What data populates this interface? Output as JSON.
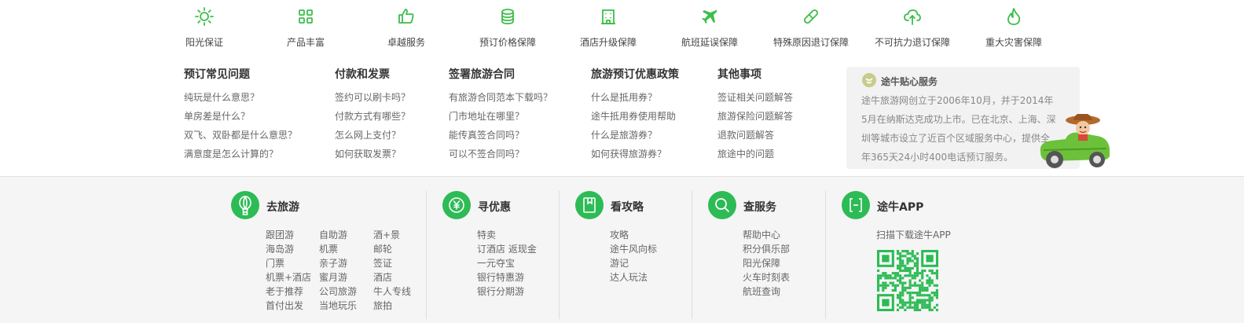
{
  "guarantees": [
    {
      "label": "阳光保证",
      "icon": "sun-icon"
    },
    {
      "label": "产品丰富",
      "icon": "grid-icon"
    },
    {
      "label": "卓越服务",
      "icon": "thumbs-up-icon"
    },
    {
      "label": "预订价格保障",
      "icon": "coins-stack-icon"
    },
    {
      "label": "酒店升级保障",
      "icon": "hotel-building-icon"
    },
    {
      "label": "航班延误保障",
      "icon": "airplane-icon"
    },
    {
      "label": "特殊原因退订保障",
      "icon": "pill-icon"
    },
    {
      "label": "不可抗力退订保障",
      "icon": "cloud-upload-icon"
    },
    {
      "label": "重大灾害保障",
      "icon": "flame-icon"
    }
  ],
  "help": [
    {
      "title": "预订常见问题",
      "links": [
        "纯玩是什么意思？",
        "单房差是什么？",
        "双飞、双卧都是什么意思？",
        "满意度是怎么计算的？"
      ]
    },
    {
      "title": "付款和发票",
      "links": [
        "签约可以刷卡吗？",
        "付款方式有哪些？",
        "怎么网上支付？",
        "如何获取发票？"
      ]
    },
    {
      "title": "签署旅游合同",
      "links": [
        "有旅游合同范本下载吗？",
        "门市地址在哪里？",
        "能传真签合同吗？",
        "可以不签合同吗？"
      ]
    },
    {
      "title": "旅游预订优惠政策",
      "links": [
        "什么是抵用券？",
        "途牛抵用券使用帮助",
        "什么是旅游券？",
        "如何获得旅游券？"
      ]
    },
    {
      "title": "其他事项",
      "links": [
        "签证相关问题解答",
        "旅游保险问题解答",
        "退款问题解答",
        "旅途中的问题"
      ]
    }
  ],
  "service": {
    "title": "途牛贴心服务",
    "text": "途牛旅游网创立于2006年10月，并于2014年5月在纳斯达克成功上市。已在北京、上海、深圳等城市设立了近百个区域服务中心，提供全年365天24小时400电话预订服务。"
  },
  "groups": [
    {
      "title": "去旅游",
      "icon": "balloon-icon",
      "columns": [
        [
          "跟团游",
          "海岛游",
          "门票",
          "机票+酒店",
          "老于推荐",
          "首付出发"
        ],
        [
          "自助游",
          "机票",
          "亲子游",
          "蜜月游",
          "公司旅游",
          "当地玩乐"
        ],
        [
          "酒+景",
          "邮轮",
          "签证",
          "酒店",
          "牛人专线",
          "旅拍"
        ]
      ]
    },
    {
      "title": "寻优惠",
      "icon": "yen-coin-icon",
      "columns": [
        [
          "特卖",
          "订酒店 返现金",
          "一元夺宝",
          "银行特惠游",
          "银行分期游"
        ]
      ]
    },
    {
      "title": "看攻略",
      "icon": "bookmark-doc-icon",
      "columns": [
        [
          "攻略",
          "途牛风向标",
          "游记",
          "达人玩法"
        ]
      ]
    },
    {
      "title": "查服务",
      "icon": "search-icon",
      "columns": [
        [
          "帮助中心",
          "积分俱乐部",
          "阳光保障",
          "火车时刻表",
          "航班查询"
        ]
      ]
    },
    {
      "title": "途牛APP",
      "icon": "app-scan-icon",
      "columns": [
        [
          "扫描下载途牛APP"
        ]
      ]
    }
  ],
  "colors": {
    "accent": "#2dbb55",
    "guarantee_icon": "#3cbf4a"
  }
}
